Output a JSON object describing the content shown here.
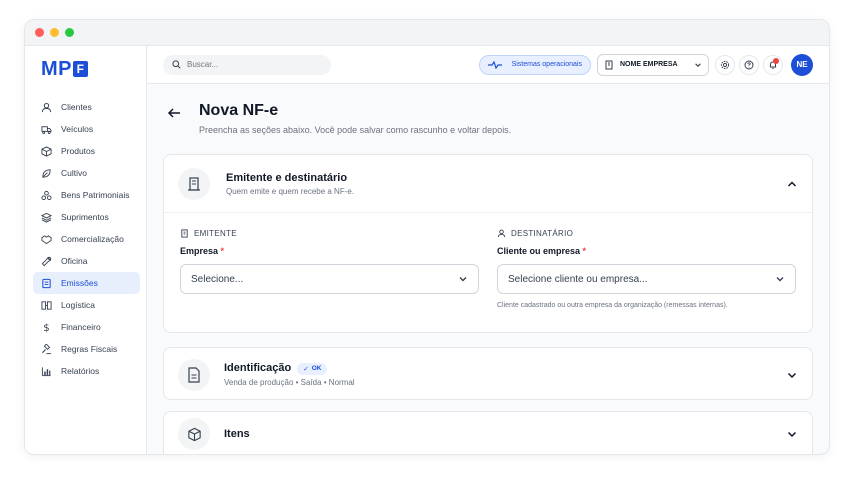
{
  "logo": {
    "text": "MP",
    "mark": "F"
  },
  "window_dots": [
    "#ff5f57",
    "#febc2e",
    "#28c840"
  ],
  "search": {
    "placeholder": "Buscar..."
  },
  "topbar": {
    "status": "Sistemas operacionais",
    "company": "NOME EMPRESA",
    "avatar": "NE"
  },
  "sidebar": {
    "items": [
      {
        "label": "Clientes",
        "icon": "user-icon"
      },
      {
        "label": "Veículos",
        "icon": "truck-icon"
      },
      {
        "label": "Produtos",
        "icon": "box-icon"
      },
      {
        "label": "Cultivo",
        "icon": "leaf-icon"
      },
      {
        "label": "Bens Patrimoniais",
        "icon": "assets-icon"
      },
      {
        "label": "Suprimentos",
        "icon": "layers-icon"
      },
      {
        "label": "Comercialização",
        "icon": "handshake-icon"
      },
      {
        "label": "Oficina",
        "icon": "wrench-icon"
      },
      {
        "label": "Emissões",
        "icon": "document-icon"
      },
      {
        "label": "Logística",
        "icon": "route-icon"
      },
      {
        "label": "Financeiro",
        "icon": "dollar-icon"
      },
      {
        "label": "Regras Fiscais",
        "icon": "gavel-icon"
      },
      {
        "label": "Relatórios",
        "icon": "chart-icon"
      }
    ],
    "active_index": 8
  },
  "page": {
    "title": "Nova NF-e",
    "subtitle": "Preencha as seções abaixo. Você pode salvar como rascunho e voltar depois."
  },
  "emitente_card": {
    "title": "Emitente e destinatário",
    "subtitle": "Quem emite e quem recebe a NF-e.",
    "emitente": {
      "section": "EMITENTE",
      "field_label": "Empresa",
      "required": "*",
      "value": "Selecione..."
    },
    "destinatario": {
      "section": "DESTINATÁRIO",
      "field_label": "Cliente ou empresa",
      "required": "*",
      "value": "Selecione cliente ou empresa...",
      "help": "Cliente cadastrado ou outra empresa da organização (remessas internas)."
    }
  },
  "identificacao_card": {
    "title": "Identificação",
    "badge": "OK",
    "subtitle": "Venda de produção • Saída • Normal"
  },
  "itens_card": {
    "title": "Itens"
  },
  "colors": {
    "accent": "#1d4ed8",
    "active_bg": "#e7eefc",
    "required": "#ef4444"
  }
}
